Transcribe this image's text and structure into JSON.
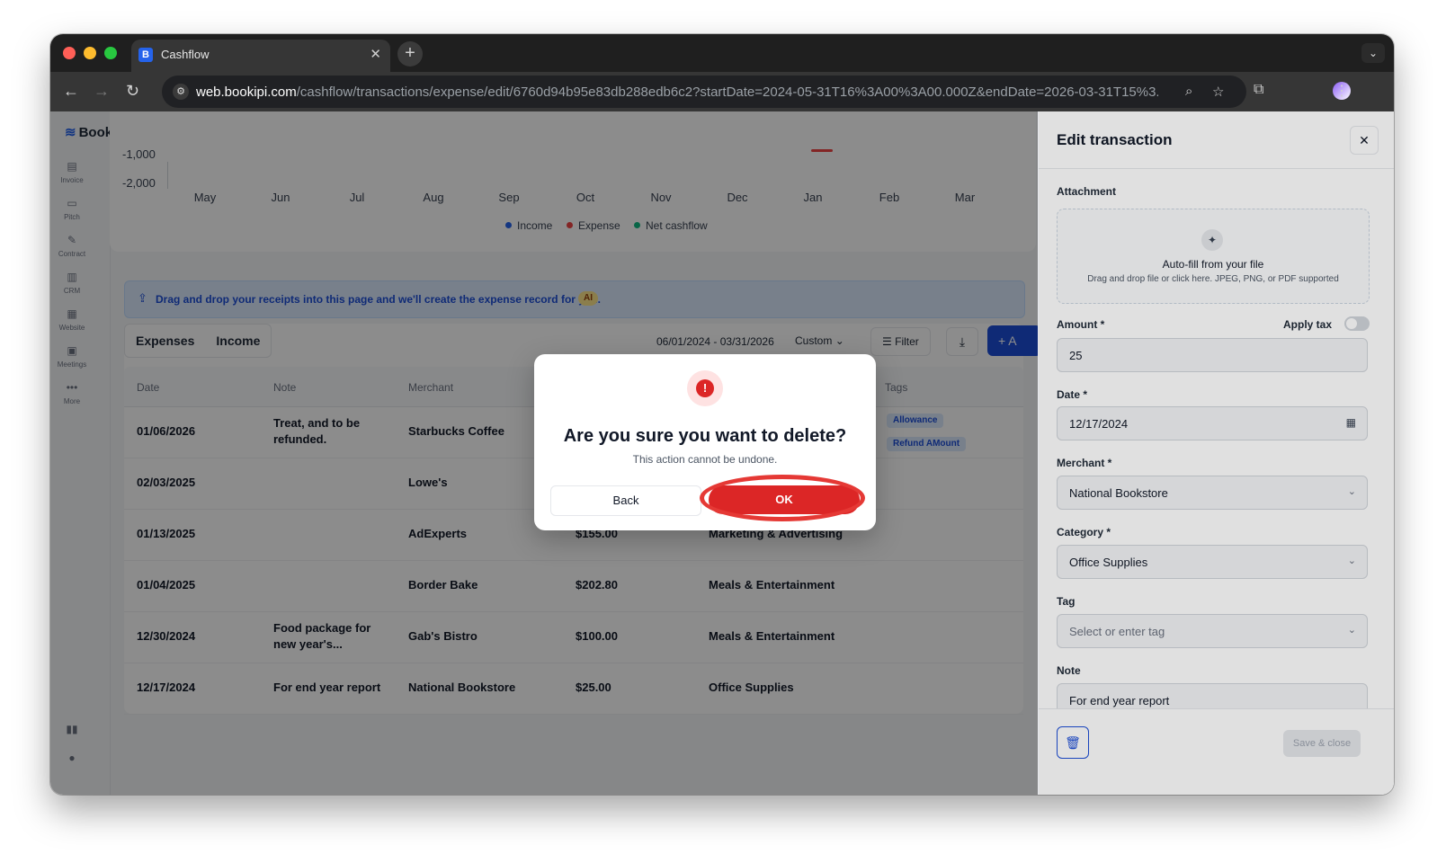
{
  "browser": {
    "tab_title": "Cashflow",
    "favicon": "B",
    "url_host": "web.bookipi.com",
    "url_path": "/cashflow/transactions/expense/edit/6760d94b95e83db288edb6c2?startDate=2024-05-31T16%3A00%3A00.000Z&endDate=2026-03-31T15%3...",
    "new_tab": "+",
    "tab_close": "✕"
  },
  "app": {
    "logo": "Bookipi",
    "sidebar": [
      {
        "label": "Invoice",
        "icon": "invoice-icon"
      },
      {
        "label": "Pitch",
        "icon": "pitch-icon"
      },
      {
        "label": "Contract",
        "icon": "contract-icon"
      },
      {
        "label": "CRM",
        "icon": "crm-icon"
      },
      {
        "label": "Website",
        "icon": "website-icon"
      },
      {
        "label": "Meetings",
        "icon": "meetings-icon"
      },
      {
        "label": "More",
        "icon": "more-icon"
      }
    ]
  },
  "chart_data": {
    "type": "bar",
    "y_ticks": [
      "-1,000",
      "-2,000"
    ],
    "categories": [
      "May",
      "Jun",
      "Jul",
      "Aug",
      "Sep",
      "Oct",
      "Nov",
      "Dec",
      "Jan",
      "Feb",
      "Mar"
    ],
    "legend": [
      {
        "name": "Income",
        "color": "#2563eb"
      },
      {
        "name": "Expense",
        "color": "#ef4444"
      },
      {
        "name": "Net cashflow",
        "color": "#10b981"
      }
    ]
  },
  "banner": {
    "text": "Drag and drop your receipts into this page and we'll create the expense record for you.",
    "badge": "AI"
  },
  "filters": {
    "tabs": [
      "Expenses",
      "Income"
    ],
    "date_range": "06/01/2024 - 03/31/2026",
    "range_select": "Custom",
    "filter_label": "Filter",
    "add_label": "+ A"
  },
  "table": {
    "headers": {
      "date": "Date",
      "note": "Note",
      "merchant": "Merchant",
      "tags": "Tags"
    },
    "rows": [
      {
        "date": "01/06/2026",
        "note": "Treat, and to be refunded.",
        "merchant": "Starbucks Coffee",
        "amount": "",
        "category": "",
        "tags": [
          "Allowance",
          "Refund AMount"
        ]
      },
      {
        "date": "02/03/2025",
        "note": "",
        "merchant": "Lowe's",
        "amount": "",
        "category": "",
        "tags": []
      },
      {
        "date": "01/13/2025",
        "note": "",
        "merchant": "AdExperts",
        "amount": "$155.00",
        "category": "Marketing & Advertising",
        "tags": []
      },
      {
        "date": "01/04/2025",
        "note": "",
        "merchant": "Border Bake",
        "amount": "$202.80",
        "category": "Meals & Entertainment",
        "tags": []
      },
      {
        "date": "12/30/2024",
        "note": "Food package for new year's...",
        "merchant": "Gab's Bistro",
        "amount": "$100.00",
        "category": "Meals & Entertainment",
        "tags": []
      },
      {
        "date": "12/17/2024",
        "note": "For end year report",
        "merchant": "National Bookstore",
        "amount": "$25.00",
        "category": "Office Supplies",
        "tags": []
      }
    ]
  },
  "drawer": {
    "title": "Edit transaction",
    "attachment_label": "Attachment",
    "dropzone_title": "Auto-fill from your file",
    "dropzone_sub": "Drag and drop file or click here. JPEG, PNG, or PDF supported",
    "amount_label": "Amount *",
    "apply_tax_label": "Apply tax",
    "amount_value": "25",
    "date_label": "Date *",
    "date_value": "12/17/2024",
    "merchant_label": "Merchant *",
    "merchant_value": "National Bookstore",
    "category_label": "Category *",
    "category_value": "Office Supplies",
    "tag_label": "Tag",
    "tag_placeholder": "Select or enter tag",
    "note_label": "Note",
    "note_value": "For end year report",
    "save_close": "Save & close"
  },
  "modal": {
    "title": "Are you sure you want to delete?",
    "subtitle": "This action cannot be undone.",
    "back_label": "Back",
    "ok_label": "OK",
    "icon": "!"
  },
  "colors": {
    "accent": "#1d4ed8",
    "danger": "#dc2626",
    "highlight": "#e53935"
  }
}
